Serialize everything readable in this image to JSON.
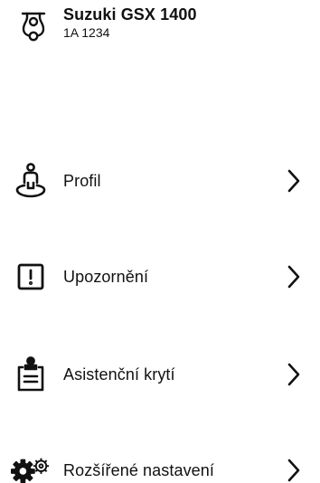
{
  "vehicle": {
    "name": "Suzuki GSX 1400",
    "plate": "1A 1234",
    "icon": "scooter-icon"
  },
  "menu": {
    "items": [
      {
        "label": "Profil",
        "icon": "profile-pin-icon"
      },
      {
        "label": "Upozornění",
        "icon": "alert-box-icon"
      },
      {
        "label": "Asistenční krytí",
        "icon": "clipboard-icon"
      },
      {
        "label": "Rozšířené nastavení",
        "icon": "gears-icon"
      }
    ]
  },
  "colors": {
    "text": "#111111",
    "background": "#ffffff"
  }
}
